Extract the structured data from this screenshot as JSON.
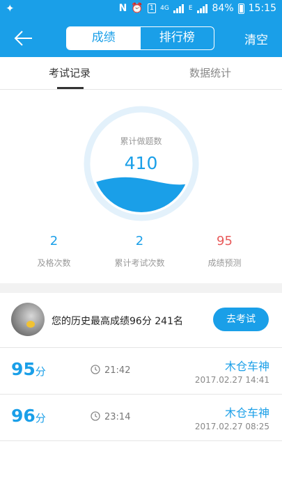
{
  "status_bar": {
    "battery_percent": "84%",
    "time": "15:15",
    "network_label": "4G",
    "n_badge": "N",
    "one_badge": "1",
    "e_label": "E",
    "icons": [
      "usb-icon",
      "nfc-icon",
      "alarm-icon",
      "sim-icon",
      "signal-icon",
      "battery-icon"
    ]
  },
  "navbar": {
    "segments": [
      "成绩",
      "排行榜"
    ],
    "active_segment": "成绩",
    "clear_label": "清空",
    "accent_color": "#1a9fe8"
  },
  "tabs": [
    "考试记录",
    "数据统计"
  ],
  "active_tab": "考试记录",
  "gauge": {
    "label": "累计做题数",
    "value": "410"
  },
  "stats": [
    {
      "value": "2",
      "label": "及格次数"
    },
    {
      "value": "2",
      "label": "累计考试次数"
    },
    {
      "value": "95",
      "label": "成绩预测",
      "color": "#e85a5a"
    }
  ],
  "best": {
    "text": "您的历史最高成绩96分  241名",
    "button_label": "去考试"
  },
  "records": [
    {
      "score": "95",
      "unit": "分",
      "duration": "21:42",
      "name": "木仓车神",
      "date": "2017.02.27  14:41"
    },
    {
      "score": "96",
      "unit": "分",
      "duration": "23:14",
      "name": "木仓车神",
      "date": "2017.02.27  08:25"
    }
  ]
}
